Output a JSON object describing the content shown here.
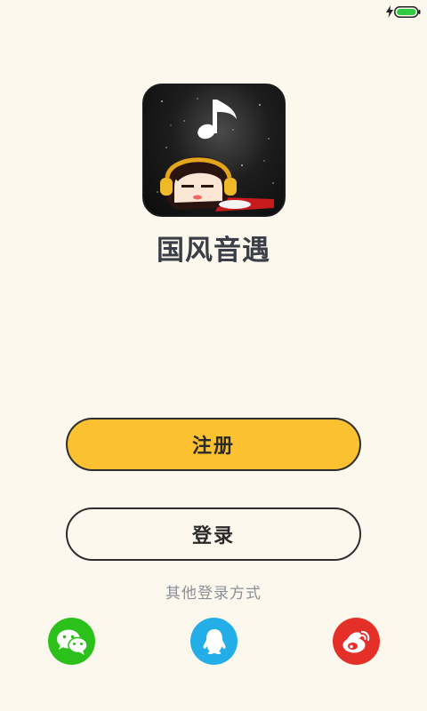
{
  "app": {
    "name": "国风音遇"
  },
  "actions": {
    "register_label": "注册",
    "login_label": "登录"
  },
  "other_login": {
    "label": "其他登录方式",
    "providers": [
      {
        "name": "WeChat",
        "icon": "wechat-icon",
        "color": "#2cc11a"
      },
      {
        "name": "QQ",
        "icon": "qq-icon",
        "color": "#24aee8"
      },
      {
        "name": "Weibo",
        "icon": "weibo-icon",
        "color": "#e5302a"
      }
    ]
  },
  "theme": {
    "background": "#fdf8ee",
    "accent": "#fcc131"
  },
  "status_bar": {
    "icons": [
      "charging-icon",
      "battery-icon"
    ]
  }
}
